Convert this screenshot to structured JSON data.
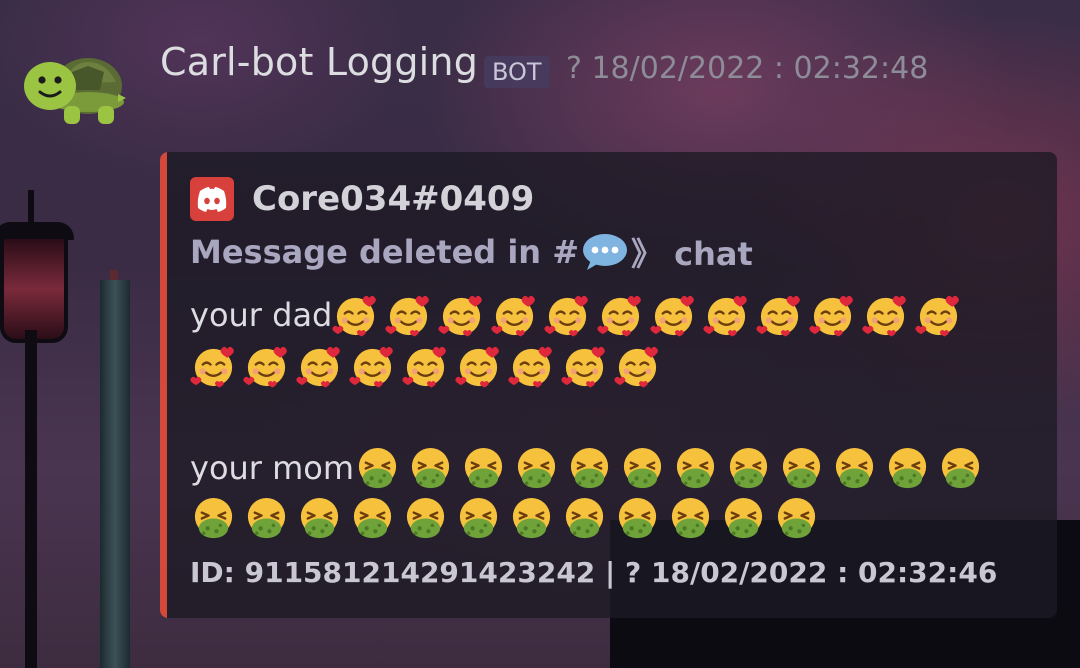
{
  "message": {
    "author_name": "Carl-bot Logging",
    "bot_tag": "BOT",
    "timestamp": "? 18/02/2022 : 02:32:48",
    "avatar": "turtle-emoji-icon"
  },
  "embed": {
    "accent_color": "#d5493b",
    "author_icon": "discord-logo-icon",
    "author": "Core034#0409",
    "title_prefix": "Message deleted in #",
    "title_icon": "speech-balloon-emoji-icon",
    "title_suffix": "》 chat",
    "description": [
      {
        "text": "your dad",
        "emoji": "smiling-face-with-hearts-emoji",
        "count": 12
      },
      {
        "text": "",
        "emoji": "smiling-face-with-hearts-emoji",
        "count": 9
      },
      {
        "text": "your mom",
        "emoji": "face-vomiting-emoji",
        "count": 12
      },
      {
        "text": "",
        "emoji": "face-vomiting-emoji",
        "count": 12
      }
    ],
    "footer": "ID: 911581214291423242 | ? 18/02/2022 : 02:32:46"
  }
}
